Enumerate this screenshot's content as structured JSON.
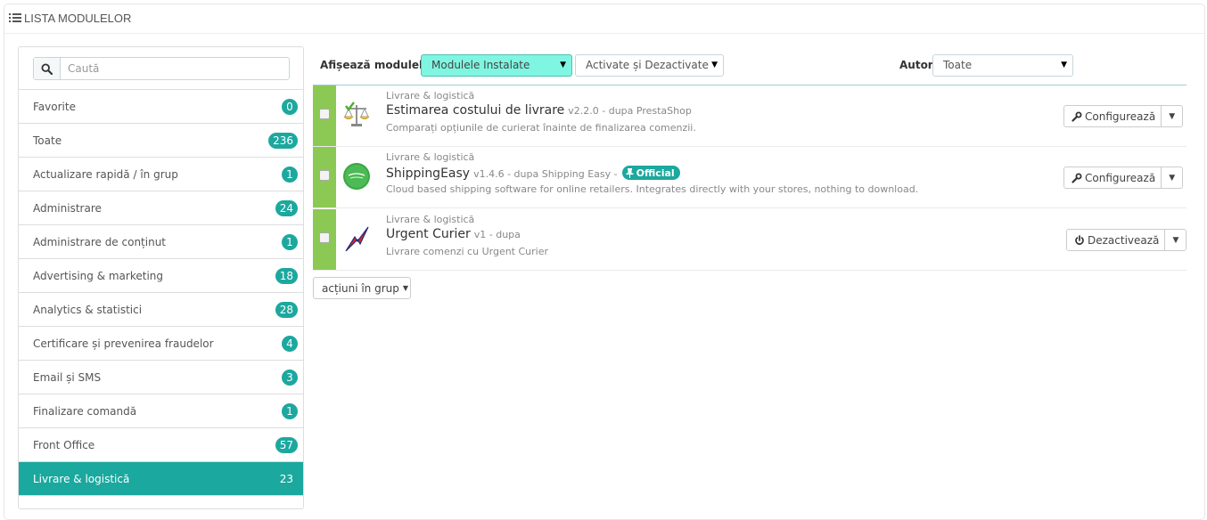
{
  "panel": {
    "title": "LISTA MODULELOR"
  },
  "sidebar": {
    "search_placeholder": "Caută",
    "categories": [
      {
        "label": "Favorite",
        "count": "0"
      },
      {
        "label": "Toate",
        "count": "236"
      },
      {
        "label": "Actualizare rapidă / în grup",
        "count": "1"
      },
      {
        "label": "Administrare",
        "count": "24"
      },
      {
        "label": "Administrare de conținut",
        "count": "1"
      },
      {
        "label": "Advertising & marketing",
        "count": "18"
      },
      {
        "label": "Analytics & statistici",
        "count": "28"
      },
      {
        "label": "Certificare și prevenirea fraudelor",
        "count": "4"
      },
      {
        "label": "Email și SMS",
        "count": "3"
      },
      {
        "label": "Finalizare comandă",
        "count": "1"
      },
      {
        "label": "Front Office",
        "count": "57"
      },
      {
        "label": "Livrare & logistică",
        "count": "23",
        "active": true
      }
    ]
  },
  "filters": {
    "show_label": "Afișează modulele",
    "installed_value": "Modulele Instalate",
    "status_value": "Activate și Dezactivate",
    "author_label": "Autor",
    "author_value": "Toate"
  },
  "modules": [
    {
      "category": "Livrare & logistică",
      "name": "Estimarea costului de livrare",
      "version": "v2.2.0 - dupa PrestaShop",
      "description": "Comparați opțiunile de curierat înainte de finalizarea comenzii.",
      "action": "Configurează",
      "official": false
    },
    {
      "category": "Livrare & logistică",
      "name": "ShippingEasy",
      "version": "v1.4.6 - dupa Shipping Easy -",
      "description": "Cloud based shipping software for online retailers. Integrates directly with your stores, nothing to download.",
      "action": "Configurează",
      "official": true,
      "official_label": "Official"
    },
    {
      "category": "Livrare & logistică",
      "name": "Urgent Curier",
      "version": "v1 - dupa",
      "description": "Livrare comenzi cu Urgent Curier",
      "action": "Dezactivează",
      "official": false
    }
  ],
  "bulk_actions_label": "acțiuni în grup",
  "colors": {
    "accent": "#1ca89e",
    "status_bar": "#8bc954",
    "highlight_select": "#7ff6e2"
  }
}
